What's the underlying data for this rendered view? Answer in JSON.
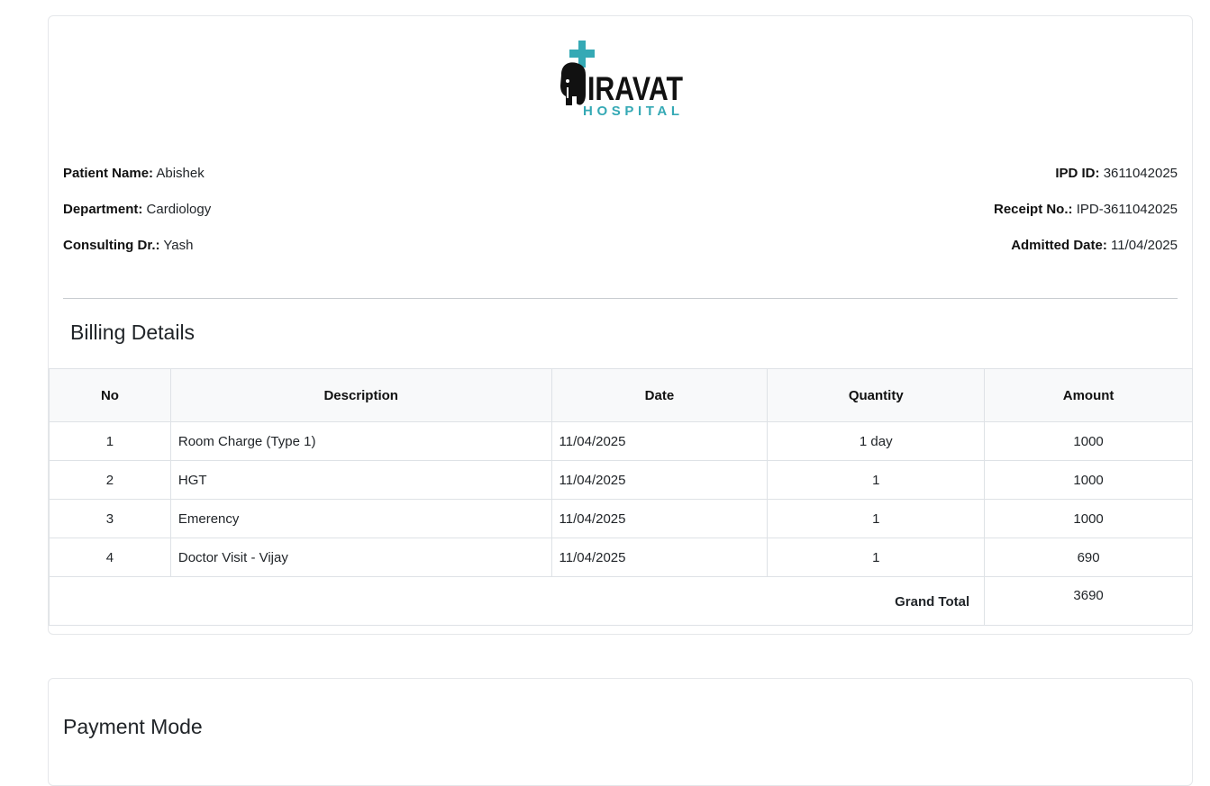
{
  "logo": {
    "name": "IRAVAT",
    "sub": "HOSPITAL",
    "accent": "#35a9b5"
  },
  "patient": {
    "name_label": "Patient Name:",
    "name": "Abishek",
    "department_label": "Department:",
    "department": "Cardiology",
    "doctor_label": "Consulting Dr.:",
    "doctor": "Yash",
    "ipd_label": "IPD ID:",
    "ipd": "3611042025",
    "receipt_label": "Receipt No.:",
    "receipt": "IPD-3611042025",
    "admitted_label": "Admitted Date:",
    "admitted": "11/04/2025"
  },
  "billing": {
    "title": "Billing Details",
    "headers": [
      "No",
      "Description",
      "Date",
      "Quantity",
      "Amount"
    ],
    "rows": [
      {
        "no": "1",
        "description": "Room Charge (Type 1)",
        "date": "11/04/2025",
        "quantity": "1 day",
        "amount": "1000"
      },
      {
        "no": "2",
        "description": "HGT",
        "date": "11/04/2025",
        "quantity": "1",
        "amount": "1000"
      },
      {
        "no": "3",
        "description": "Emerency",
        "date": "11/04/2025",
        "quantity": "1",
        "amount": "1000"
      },
      {
        "no": "4",
        "description": "Doctor Visit - Vijay",
        "date": "11/04/2025",
        "quantity": "1",
        "amount": "690"
      }
    ],
    "grand_total_label": "Grand Total",
    "grand_total": "3690"
  },
  "payment": {
    "title": "Payment Mode"
  }
}
